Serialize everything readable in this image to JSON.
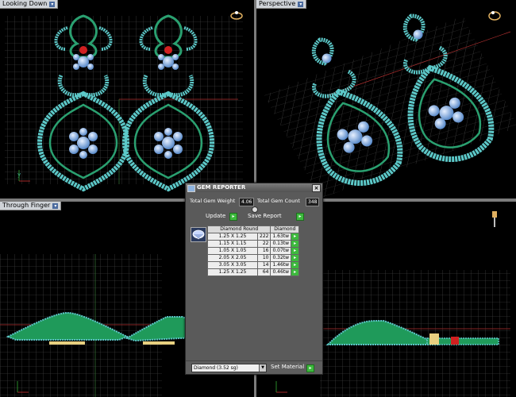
{
  "viewports": {
    "looking_down": "Looking Down",
    "perspective": "Perspective",
    "through_finger": "Through Finger"
  },
  "gem_reporter": {
    "title": "GEM REPORTER",
    "total_weight_label": "Total Gem Weight",
    "total_weight_value": "4.06",
    "total_count_label": "Total Gem Count",
    "total_count_value": "348",
    "update_label": "Update",
    "save_report_label": "Save Report",
    "columns": [
      "Diamond Round",
      "Diamond"
    ],
    "rows": [
      {
        "size": "1.25 X 1.25",
        "count": "222",
        "weight": "1.63tw"
      },
      {
        "size": "1.15 X 1.15",
        "count": "22",
        "weight": "0.13tw"
      },
      {
        "size": "1.05 X 1.05",
        "count": "16",
        "weight": "0.07tw"
      },
      {
        "size": "2.05 X 2.05",
        "count": "10",
        "weight": "0.32tw"
      },
      {
        "size": "3.05 X 3.05",
        "count": "14",
        "weight": "1.46tw"
      },
      {
        "size": "1.25 X 1.25",
        "count": "64",
        "weight": "0.46tw"
      }
    ],
    "material_select": "Diamond   (3.52 sg)",
    "set_material_label": "Set Material"
  },
  "colors": {
    "gem": "#69c8c8",
    "metal": "#1f9a5a",
    "center": "#7fb0e8",
    "ruby": "#d02020",
    "grid": "#5a5a5a"
  }
}
